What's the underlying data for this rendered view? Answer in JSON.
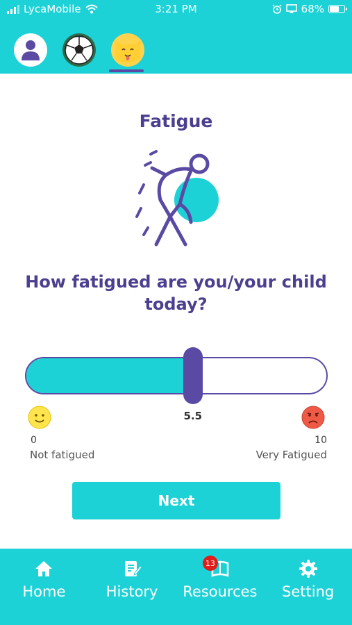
{
  "status_bar": {
    "carrier": "LycaMobile",
    "time": "3:21 PM",
    "battery": "68%"
  },
  "profiles": [
    {
      "name": "user-avatar-icon",
      "selected": false
    },
    {
      "name": "soccer-ball-avatar-icon",
      "selected": false
    },
    {
      "name": "cat-avatar-icon",
      "selected": true
    }
  ],
  "screen": {
    "title": "Fatigue",
    "question": "How fatigued are you/your child today?"
  },
  "slider": {
    "value": 5.5,
    "value_label": "5.5",
    "min": 0,
    "max": 10,
    "min_label": "0",
    "max_label": "10",
    "min_text": "Not fatigued",
    "max_text": "Very Fatigued",
    "fill_color": "#1dd2d6",
    "thumb_color": "#5b4aa3"
  },
  "next_button": {
    "label": "Next"
  },
  "tabbar": {
    "items": [
      {
        "label": "Home",
        "icon": "home-icon"
      },
      {
        "label": "History",
        "icon": "history-icon"
      },
      {
        "label": "Resources",
        "icon": "resources-icon",
        "badge": "13"
      },
      {
        "label": "Setting",
        "icon": "gear-icon"
      }
    ]
  },
  "colors": {
    "accent": "#1dd2d6",
    "primary": "#4d3f8f",
    "badge": "#e21b1b"
  }
}
